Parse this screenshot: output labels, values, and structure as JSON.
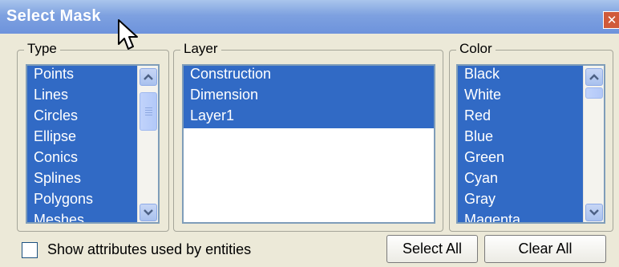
{
  "window": {
    "title": "Select Mask",
    "close_glyph": "✕"
  },
  "groups": {
    "type": {
      "label": "Type",
      "items": [
        "Points",
        "Lines",
        "Circles",
        "Ellipse",
        "Conics",
        "Splines",
        "Polygons",
        "Meshes"
      ]
    },
    "layer": {
      "label": "Layer",
      "items": [
        "Construction",
        "Dimension",
        "Layer1"
      ]
    },
    "color": {
      "label": "Color",
      "items": [
        "Black",
        "White",
        "Red",
        "Blue",
        "Green",
        "Cyan",
        "Gray",
        "Magenta"
      ]
    }
  },
  "footer": {
    "checkbox_label": "Show attributes used by entities",
    "checkbox_checked": false,
    "select_all": "Select All",
    "clear_all": "Clear All"
  },
  "icons": {
    "close": "close-icon",
    "cursor": "mouse-cursor-icon",
    "scroll_up": "scroll-up-arrow-icon",
    "scroll_down": "scroll-down-arrow-icon"
  },
  "colors": {
    "selection": "#316ac5",
    "title_bar": "#7ea1e0",
    "dialog_bg": "#ece9d8"
  }
}
